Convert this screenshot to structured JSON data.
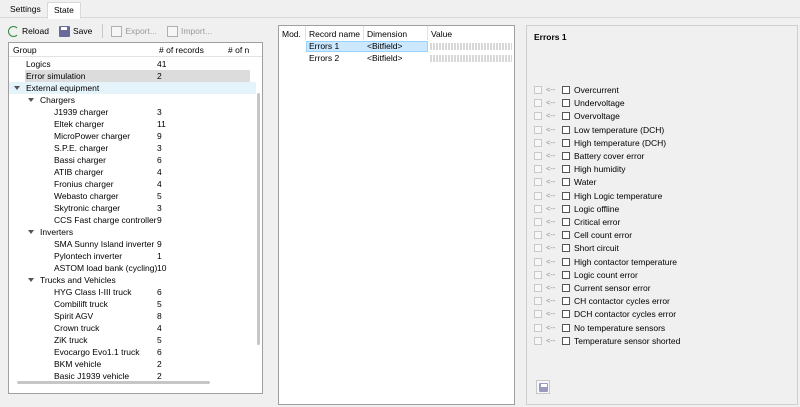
{
  "tabs": [
    {
      "label": "Settings"
    },
    {
      "label": "State"
    }
  ],
  "toolbar": {
    "reload": "Reload",
    "save": "Save",
    "export": "Export...",
    "import": "Import..."
  },
  "tree": {
    "columns": [
      "Group",
      "# of records",
      "# of n"
    ],
    "rows": [
      {
        "label": "Logics",
        "count": "41"
      },
      {
        "label": "Error simulation",
        "count": "2"
      },
      {
        "label": "External equipment",
        "count": ""
      },
      {
        "label": "Chargers",
        "count": ""
      },
      {
        "label": "J1939 charger",
        "count": "3"
      },
      {
        "label": "Eltek charger",
        "count": "11"
      },
      {
        "label": "MicroPower charger",
        "count": "9"
      },
      {
        "label": "S.P.E. charger",
        "count": "3"
      },
      {
        "label": "Bassi charger",
        "count": "6"
      },
      {
        "label": "ATIB charger",
        "count": "4"
      },
      {
        "label": "Fronius charger",
        "count": "4"
      },
      {
        "label": "Webasto charger",
        "count": "5"
      },
      {
        "label": "Skytronic charger",
        "count": "3"
      },
      {
        "label": "CCS Fast charge controller",
        "count": "9"
      },
      {
        "label": "Inverters",
        "count": ""
      },
      {
        "label": "SMA Sunny Island inverter",
        "count": "9"
      },
      {
        "label": "Pylontech inverter",
        "count": "1"
      },
      {
        "label": "ASTOM load bank (cycling)",
        "count": "10"
      },
      {
        "label": "Trucks and Vehicles",
        "count": ""
      },
      {
        "label": "HYG Class I-III truck",
        "count": "6"
      },
      {
        "label": "Combilift truck",
        "count": "5"
      },
      {
        "label": "Spirit AGV",
        "count": "8"
      },
      {
        "label": "Crown truck",
        "count": "4"
      },
      {
        "label": "ZiK truck",
        "count": "5"
      },
      {
        "label": "Evocargo Evo1.1 truck",
        "count": "6"
      },
      {
        "label": "BKM vehicle",
        "count": "2"
      },
      {
        "label": "Basic J1939 vehicle",
        "count": "2"
      }
    ]
  },
  "records": {
    "columns": [
      "Mod.",
      "Record name",
      "Dimension",
      "Value"
    ],
    "rows": [
      {
        "name": "Errors 1",
        "dimension": "<Bitfield>"
      },
      {
        "name": "Errors 2",
        "dimension": "<Bitfield>"
      }
    ]
  },
  "details": {
    "title": "Errors 1",
    "arrow": "<--",
    "flags": [
      "Overcurrent",
      "Undervoltage",
      "Overvoltage",
      "Low temperature (DCH)",
      "High temperature (DCH)",
      "Battery cover error",
      "High humidity",
      "Water",
      "High Logic temperature",
      "Logic offline",
      "Critical error",
      "Cell count error",
      "Short circuit",
      "High contactor temperature",
      "Logic count error",
      "Current sensor error",
      "CH contactor cycles error",
      "DCH contactor cycles error",
      "No temperature sensors",
      "Temperature sensor shorted"
    ]
  }
}
